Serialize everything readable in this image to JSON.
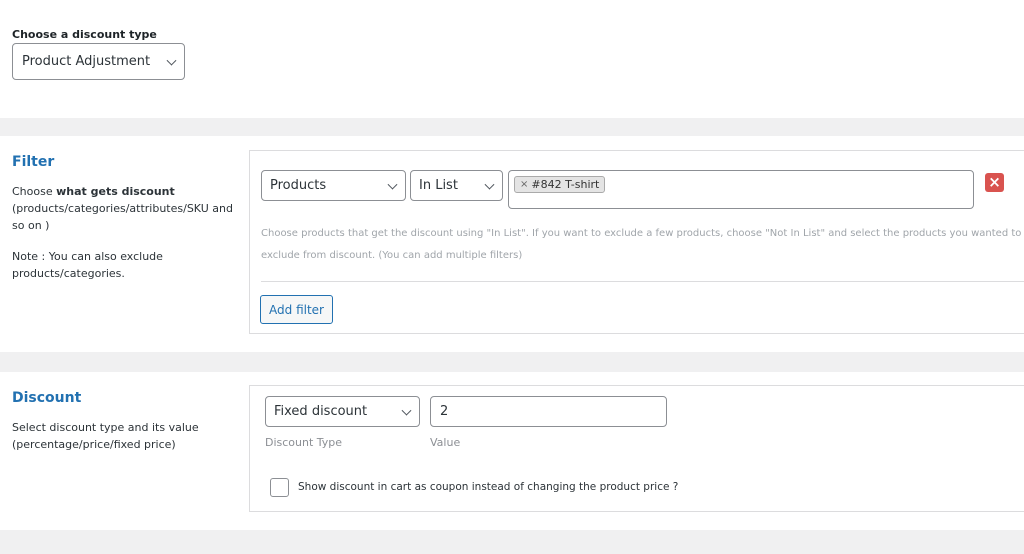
{
  "discount_type": {
    "label": "Choose a discount type",
    "selected": "Product Adjustment"
  },
  "filter": {
    "title": "Filter",
    "desc_prefix": "Choose ",
    "desc_bold": "what gets discount",
    "desc_rest": "(products/categories/attributes/SKU and so on )",
    "note": "Note : You can also exclude products/categories.",
    "row": {
      "type": "Products",
      "operator": "In List",
      "tags": [
        {
          "remove": "×",
          "label": "#842 T-shirt"
        }
      ],
      "remove_icon": "×"
    },
    "help_text": "Choose products that get the discount using \"In List\". If you want to exclude a few products, choose \"Not In List\" and select the products you wanted to exclude from discount. (You can add multiple filters)",
    "add_filter_label": "Add filter"
  },
  "discount": {
    "title": "Discount",
    "desc": "Select discount type and its value (percentage/price/fixed price)",
    "type_selected": "Fixed discount",
    "value": "2",
    "type_label": "Discount Type",
    "value_label": "Value",
    "coupon_checkbox_label": "Show discount in cart as coupon instead of changing the product price ?",
    "coupon_checked": false
  },
  "colors": {
    "accent": "#2271b1",
    "danger": "#d9534f",
    "background": "#f0f0f1"
  }
}
